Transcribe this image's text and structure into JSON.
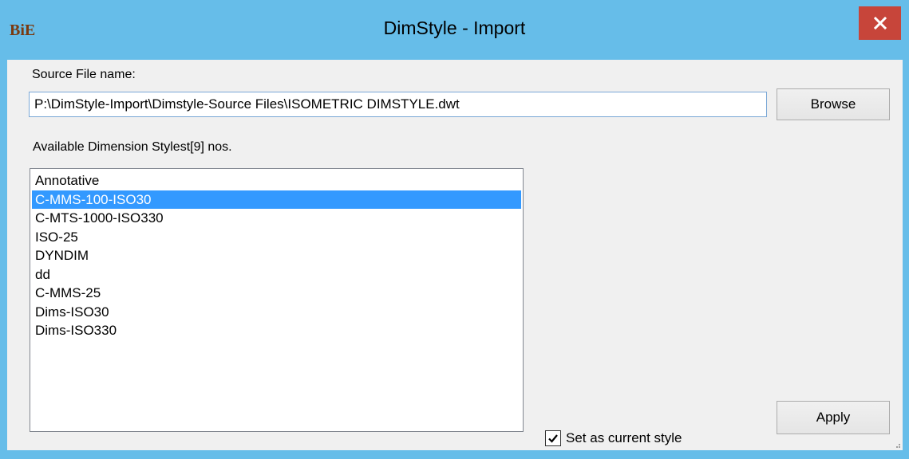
{
  "window": {
    "title": "DimStyle - Import",
    "app_icon_text": "BiE",
    "close_icon": "close-icon",
    "accent_color": "#66bde9",
    "close_color": "#c7453a"
  },
  "source": {
    "label": "Source File name:",
    "path_value": "P:\\DimStyle-Import\\Dimstyle-Source Files\\ISOMETRIC DIMSTYLE.dwt",
    "browse_label": "Browse"
  },
  "styles": {
    "label": "Available Dimension Stylest[9] nos.",
    "items": [
      "Annotative",
      "C-MMS-100-ISO30",
      "C-MTS-1000-ISO330",
      "ISO-25",
      "DYNDIM",
      "dd",
      "C-MMS-25",
      "Dims-ISO30",
      "Dims-ISO330"
    ],
    "selected_index": 1,
    "selection_color": "#3399ff"
  },
  "options": {
    "set_current_label": "Set as current style",
    "set_current_checked": true
  },
  "actions": {
    "apply_label": "Apply"
  }
}
